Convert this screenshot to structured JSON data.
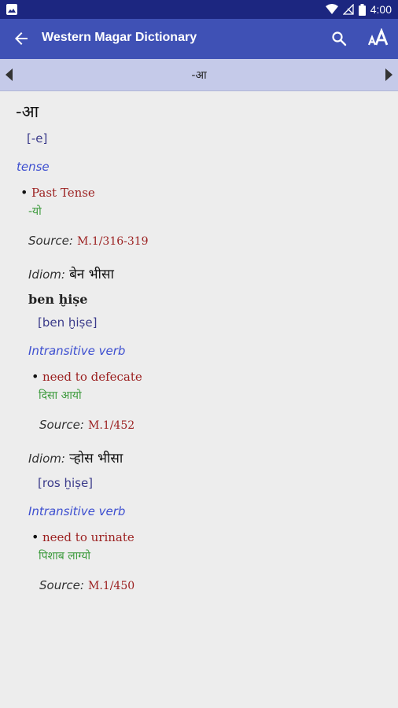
{
  "status": {
    "time": "4:00"
  },
  "appbar": {
    "title": "Western Magar Dictionary"
  },
  "navbar": {
    "current": "-आ"
  },
  "entry": {
    "headword": "-आ",
    "pron": "[-e]",
    "pos": "tense",
    "senses": [
      {
        "gloss": "Past Tense",
        "nepali": "-यो"
      }
    ],
    "source_label": "Source:",
    "source": "M.1/316-319",
    "idioms": [
      {
        "label": "Idiom:",
        "text": "बेन भीसा",
        "roman": "ben ḫiṣe",
        "pron": "[ben ḫiṣe]",
        "pos": "Intransitive verb",
        "gloss": "need to defecate",
        "nepali": "दिसा आयो",
        "source_label": "Source:",
        "source": "M.1/452"
      },
      {
        "label": "Idiom:",
        "text": "ऱ्होस भीसा",
        "pron": "[ros ḫiṣe]",
        "pos": "Intransitive verb",
        "gloss": "need to urinate",
        "nepali": "पिशाब लाग्यो",
        "source_label": "Source:",
        "source": "M.1/450"
      }
    ]
  }
}
